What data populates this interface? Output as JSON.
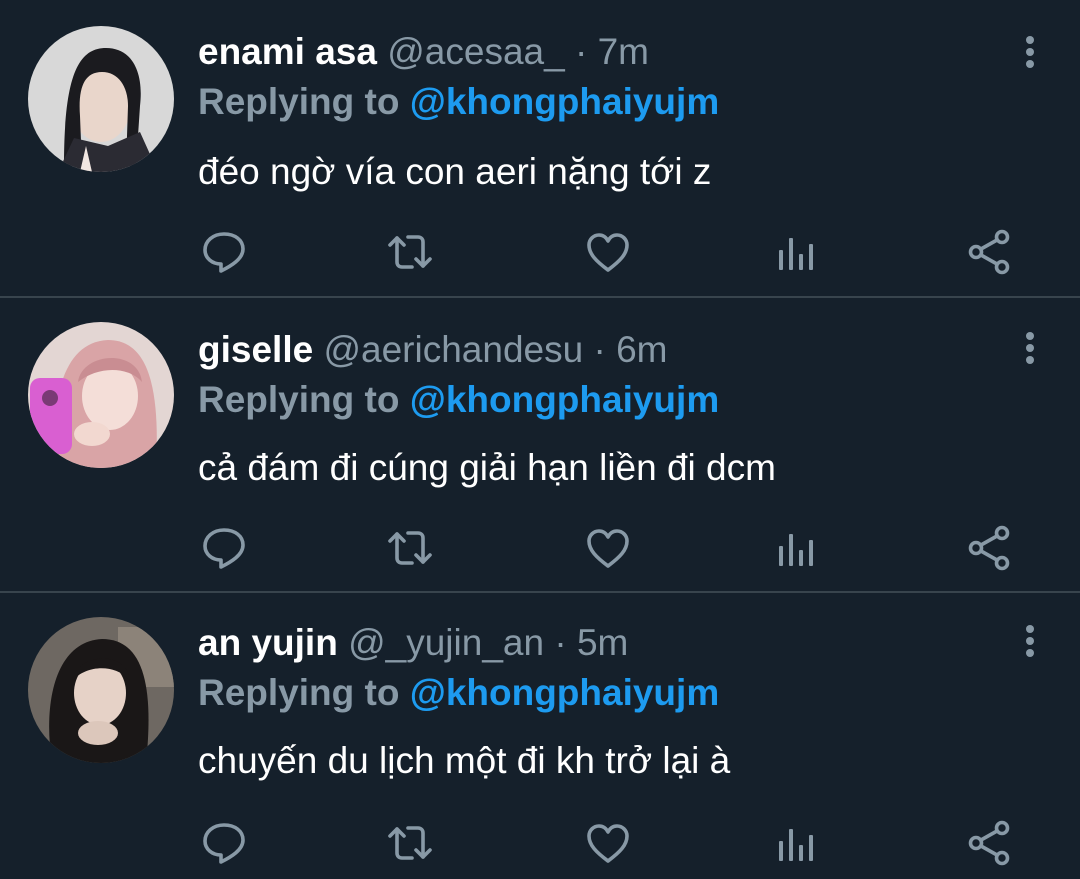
{
  "theme": {
    "background": "#15202b",
    "divider": "#38444d",
    "text_primary": "#ffffff",
    "text_secondary": "#8899a6",
    "accent": "#1d9bf0"
  },
  "tweets": [
    {
      "display_name": "enami asa",
      "handle": "@acesaa_",
      "separator": "·",
      "time": "7m",
      "replying_label": "Replying to",
      "replying_to": "@khongphaiyujm",
      "text": "đéo ngờ vía con aeri nặng tới z",
      "avatar": "avatar-photo",
      "icons": [
        "reply-icon",
        "retweet-icon",
        "like-icon",
        "analytics-icon",
        "share-icon",
        "more-options-icon"
      ]
    },
    {
      "display_name": "giselle",
      "handle": "@aerichandesu",
      "separator": "·",
      "time": "6m",
      "replying_label": "Replying to",
      "replying_to": "@khongphaiyujm",
      "text": "cả đám đi cúng giải hạn liền đi dcm",
      "avatar": "avatar-photo",
      "icons": [
        "reply-icon",
        "retweet-icon",
        "like-icon",
        "analytics-icon",
        "share-icon",
        "more-options-icon"
      ]
    },
    {
      "display_name": "an yujin",
      "handle": "@_yujin_an",
      "separator": "·",
      "time": "5m",
      "replying_label": "Replying to",
      "replying_to": "@khongphaiyujm",
      "text": "chuyến du lịch một đi kh trở lại à",
      "avatar": "avatar-photo",
      "icons": [
        "reply-icon",
        "retweet-icon",
        "like-icon",
        "analytics-icon",
        "share-icon",
        "more-options-icon"
      ]
    }
  ]
}
